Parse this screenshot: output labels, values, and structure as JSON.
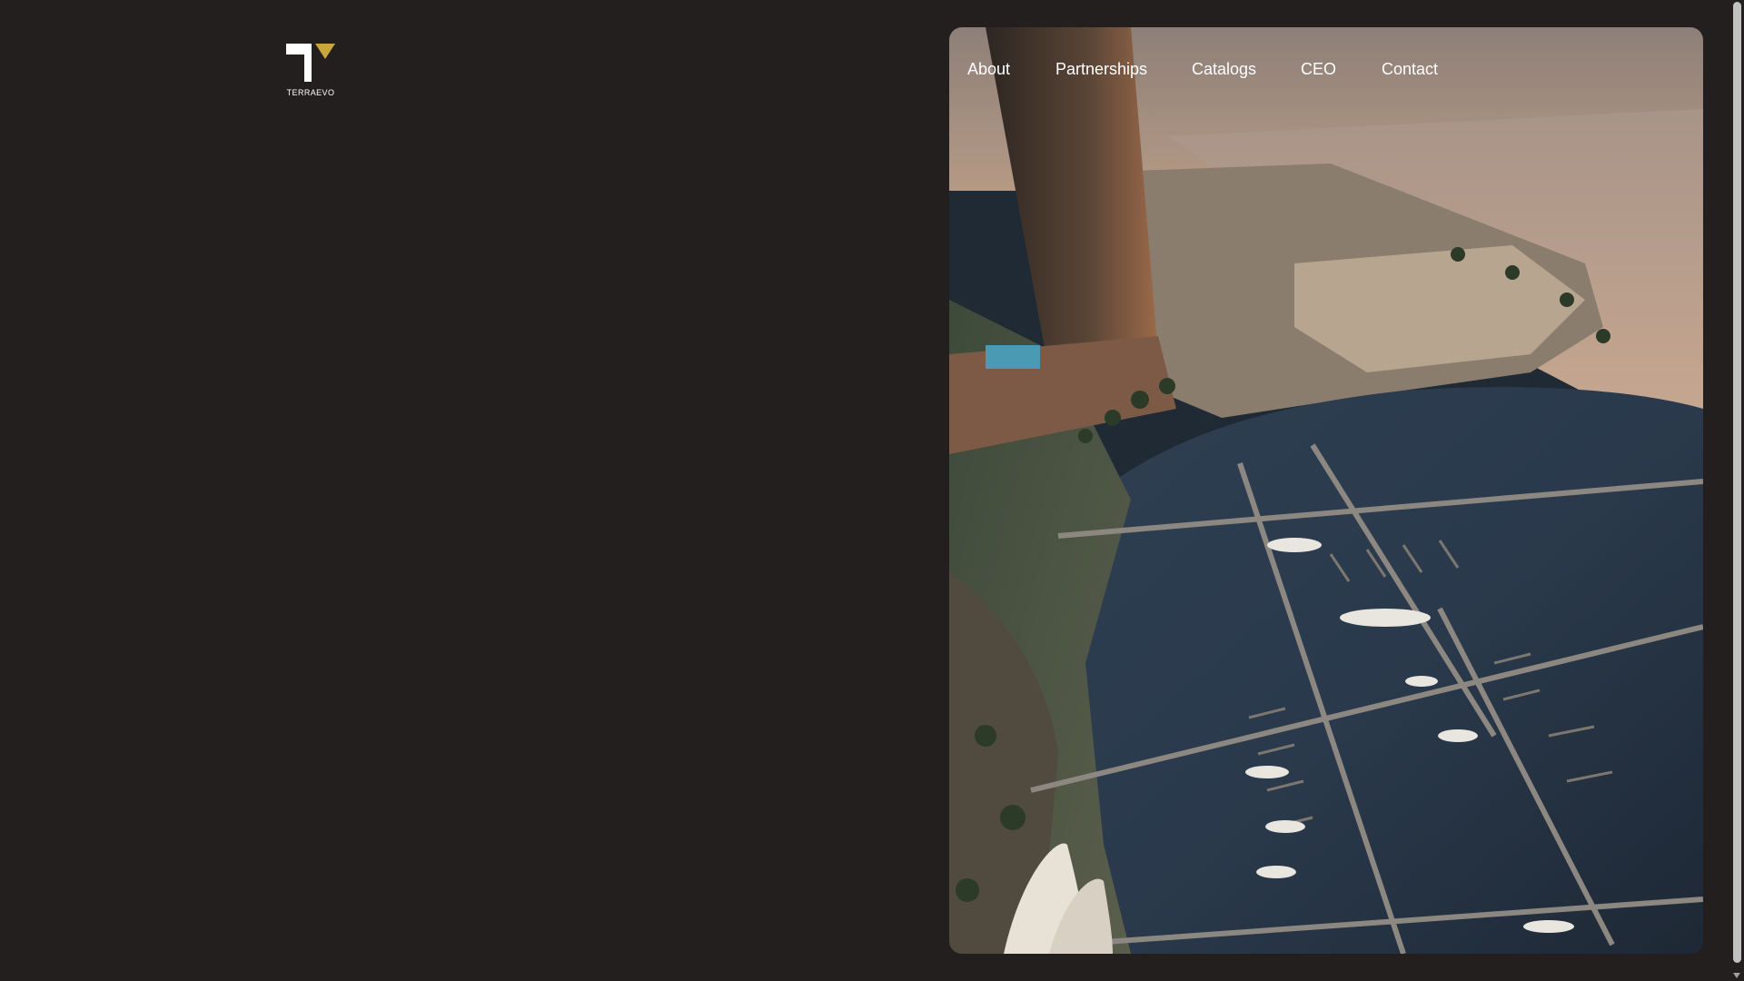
{
  "brand": {
    "name": "TERRAEVO",
    "accent_color": "#c9a53c"
  },
  "nav": {
    "items": [
      {
        "label": "About"
      },
      {
        "label": "Partnerships"
      },
      {
        "label": "Catalogs"
      },
      {
        "label": "CEO"
      },
      {
        "label": "Contact"
      }
    ]
  },
  "hero": {
    "image": "aerial-marina-photo"
  },
  "colors": {
    "background": "#241f1f",
    "nav_text": "#ffffff"
  }
}
